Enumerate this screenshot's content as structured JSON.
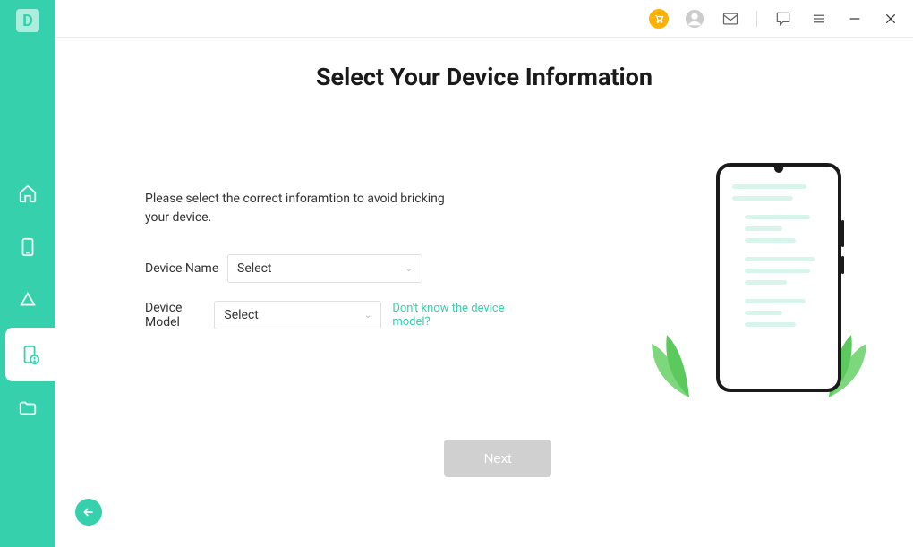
{
  "header": {
    "title": "Select Your Device Information"
  },
  "form": {
    "instruction": "Please select the correct inforamtion to avoid bricking your device.",
    "device_name_label": "Device Name",
    "device_name_value": "Select",
    "device_model_label": "Device Model",
    "device_model_value": "Select",
    "help_link": "Don't know the device model?",
    "next_label": "Next"
  },
  "sidebar": {
    "logo_letter": "D"
  }
}
